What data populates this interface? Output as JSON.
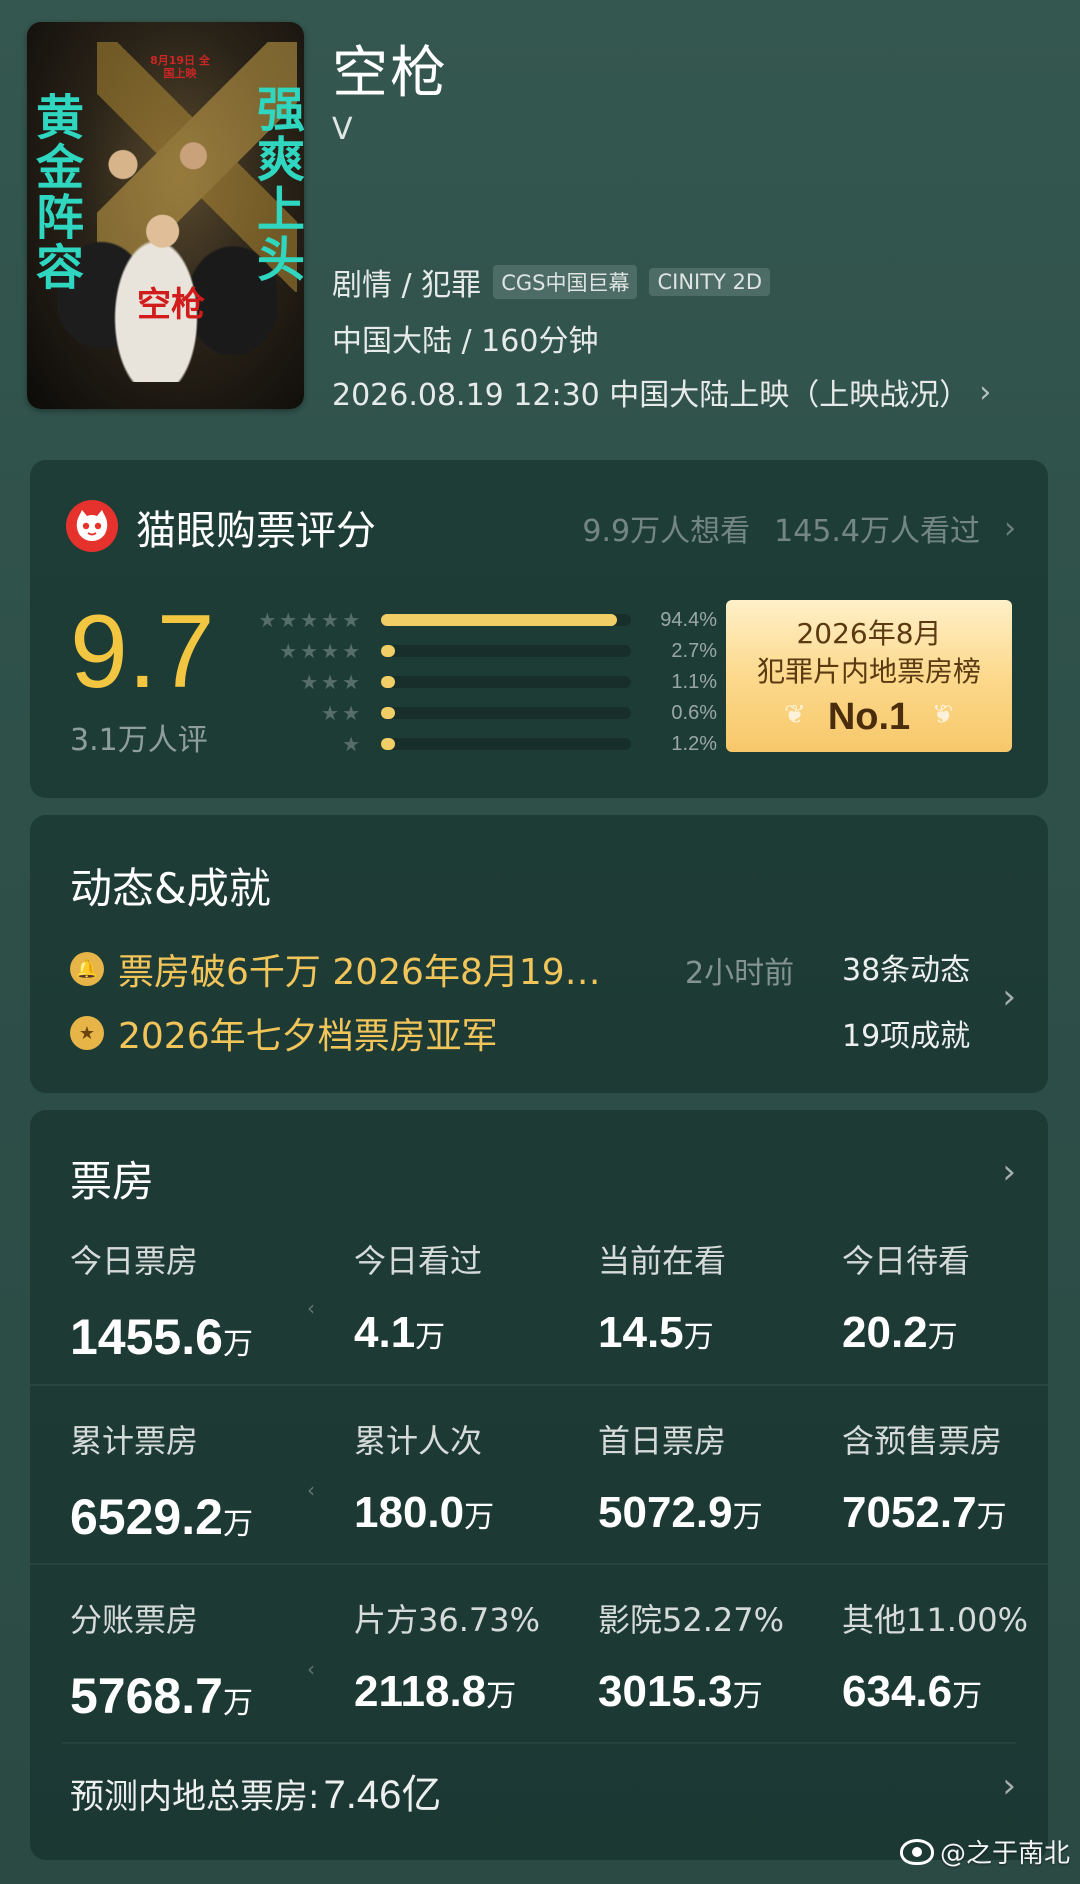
{
  "movie": {
    "poster": {
      "left_text": "黄金阵容",
      "right_text": "强爽上头",
      "red_title": "空枪",
      "date_tag": "8月19日 全国上映"
    },
    "title": "空枪",
    "subtitle": "V",
    "genre": "剧情 / 犯罪",
    "tags": [
      "CGS中国巨幕",
      "CINITY 2D"
    ],
    "region_duration": "中国大陆 / 160分钟",
    "release": "2026.08.19 12:30 中国大陆上映（上映战况）"
  },
  "rating": {
    "title": "猫眼购票评分",
    "want_to_watch": "9.9万人想看",
    "watched": "145.4万人看过",
    "score": "9.7",
    "count": "3.1万人评",
    "distribution": [
      {
        "stars": 5,
        "label": "94.4%",
        "fraction": 0.944
      },
      {
        "stars": 4,
        "label": "2.7%",
        "fraction": 0.027
      },
      {
        "stars": 3,
        "label": "1.1%",
        "fraction": 0.011
      },
      {
        "stars": 2,
        "label": "0.6%",
        "fraction": 0.006
      },
      {
        "stars": 1,
        "label": "1.2%",
        "fraction": 0.012
      }
    ],
    "rank": {
      "line1": "2026年8月",
      "line2": "犯罪片内地票房榜",
      "line3": "No.1"
    }
  },
  "dynamics": {
    "title": "动态&成就",
    "items": [
      {
        "text": "票房破6千万 2026年8月19…",
        "icon": "bell-icon"
      },
      {
        "text": "2026年七夕档票房亚军",
        "icon": "medal-icon"
      }
    ],
    "time": "2小时前",
    "count_news": "38条动态",
    "count_achievements": "19项成就"
  },
  "box_office": {
    "title": "票房",
    "rows": [
      [
        {
          "label": "今日票房",
          "value": "1455.6",
          "unit": "万"
        },
        {
          "label": "今日看过",
          "value": "4.1",
          "unit": "万"
        },
        {
          "label": "当前在看",
          "value": "14.5",
          "unit": "万"
        },
        {
          "label": "今日待看",
          "value": "20.2",
          "unit": "万"
        }
      ],
      [
        {
          "label": "累计票房",
          "value": "6529.2",
          "unit": "万"
        },
        {
          "label": "累计人次",
          "value": "180.0",
          "unit": "万"
        },
        {
          "label": "首日票房",
          "value": "5072.9",
          "unit": "万"
        },
        {
          "label": "含预售票房",
          "value": "7052.7",
          "unit": "万"
        }
      ],
      [
        {
          "label": "分账票房",
          "value": "5768.7",
          "unit": "万"
        },
        {
          "label": "片方36.73%",
          "value": "2118.8",
          "unit": "万"
        },
        {
          "label": "影院52.27%",
          "value": "3015.3",
          "unit": "万"
        },
        {
          "label": "其他11.00%",
          "value": "634.6",
          "unit": "万"
        }
      ]
    ],
    "forecast_label": "预测内地总票房:",
    "forecast_value": "7.46亿"
  },
  "watermark": "@之于南北",
  "colors": {
    "accent_gold": "#f3c641",
    "bar_fill": "#f2cf66",
    "dyn_text": "#f2c55a",
    "maoyan_red": "#e5322d"
  }
}
